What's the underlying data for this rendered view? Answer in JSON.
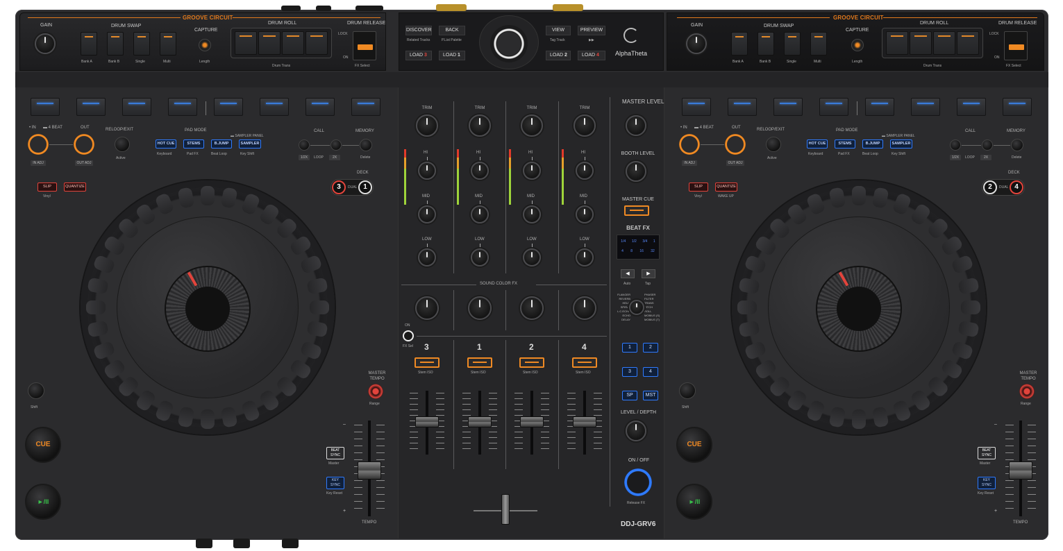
{
  "brand": {
    "logo_text": "AlphaTheta",
    "model": "DDJ-GRV6"
  },
  "browser": {
    "discover": "DISCOVER",
    "back": "BACK",
    "view": "VIEW",
    "preview": "PREVIEW",
    "related_tracks": "Related Tracks",
    "playlist_palette": "P.List Palette",
    "tag_track": "Tag Track",
    "forward": "▶▶",
    "load3": "LOAD",
    "load3_num": "3",
    "load1": "LOAD",
    "load1_num": "1",
    "load2": "LOAD",
    "load2_num": "2",
    "load4": "LOAD",
    "load4_num": "4"
  },
  "groove_left": {
    "title": "GROOVE CIRCUIT",
    "gain": "GAIN",
    "drum_swap": "DRUM SWAP",
    "capture": "CAPTURE",
    "drum_roll": "DRUM ROLL",
    "drum_release": "DRUM RELEASE",
    "lock": "LOCK",
    "on": "ON",
    "bank_a": "Bank A",
    "bank_b": "Bank B",
    "single": "Single",
    "multi": "Multi",
    "length": "Length",
    "drum_trans": "Drum Trans",
    "fx_select": "FX Select"
  },
  "groove_right": {
    "title": "GROOVE CIRCUIT",
    "gain": "GAIN",
    "drum_swap": "DRUM SWAP",
    "capture": "CAPTURE",
    "drum_roll": "DRUM ROLL",
    "drum_release": "DRUM RELEASE",
    "lock": "LOCK",
    "on": "ON",
    "bank_a": "Bank A",
    "bank_b": "Bank B",
    "single": "Single",
    "multi": "Multi",
    "length": "Length",
    "drum_trans": "Drum Trans",
    "fx_select": "FX Select"
  },
  "deck_left": {
    "in": "• IN",
    "beat4": "▬ 4 BEAT",
    "out": "OUT",
    "reloop": "RELOOP/EXIT",
    "in_adj": "IN ADJ",
    "out_adj": "OUT ADJ",
    "active": "Active",
    "pad_mode": "PAD MODE",
    "sampler_panel": "▬ SAMPLER PANEL",
    "hot_cue": "HOT CUE",
    "stems": "STEMS",
    "bjump": "B.JUMP",
    "sampler": "SAMPLER",
    "keyboard": "Keyboard",
    "pad_fx": "Pad FX",
    "beat_loop": "Beat Loop",
    "key_shift": "Key Shift",
    "call": "CALL",
    "memory": "MEMORY",
    "half": "1/2X",
    "loop": "LOOP",
    "double": "2X",
    "delete": "Delete",
    "deck": "DECK",
    "dual": "DUAL",
    "deck_a": "3",
    "deck_b": "1",
    "slip": "SLIP",
    "quantize": "QUANTIZE",
    "vinyl": "Vinyl",
    "sub2": "",
    "master_tempo": "MASTER TEMPO",
    "range": "Range",
    "shift": "Shift",
    "cue": "CUE",
    "play": "►/II",
    "beat_sync": "BEAT SYNC",
    "master": "Master",
    "key_sync": "KEY SYNC",
    "key_reset": "Key Reset",
    "minus": "–",
    "plus": "+",
    "tempo": "TEMPO"
  },
  "deck_right": {
    "in": "• IN",
    "beat4": "▬ 4 BEAT",
    "out": "OUT",
    "reloop": "RELOOP/EXIT",
    "in_adj": "IN ADJ",
    "out_adj": "OUT ADJ",
    "active": "Active",
    "pad_mode": "PAD MODE",
    "sampler_panel": "▬ SAMPLER PANEL",
    "hot_cue": "HOT CUE",
    "stems": "STEMS",
    "bjump": "B.JUMP",
    "sampler": "SAMPLER",
    "keyboard": "Keyboard",
    "pad_fx": "Pad FX",
    "beat_loop": "Beat Loop",
    "key_shift": "Key Shift",
    "call": "CALL",
    "memory": "MEMORY",
    "half": "1/2X",
    "loop": "LOOP",
    "double": "2X",
    "delete": "Delete",
    "deck": "DECK",
    "dual": "DUAL",
    "deck_a": "2",
    "deck_b": "4",
    "slip": "SLIP",
    "quantize": "QUANTIZE",
    "vinyl": "Vinyl",
    "sub2": "WAKE UP",
    "master_tempo": "MASTER TEMPO",
    "range": "Range",
    "shift": "Shift",
    "cue": "CUE",
    "play": "►/II",
    "beat_sync": "BEAT SYNC",
    "master": "Master",
    "key_sync": "KEY SYNC",
    "key_reset": "Key Reset",
    "minus": "–",
    "plus": "+",
    "tempo": "TEMPO"
  },
  "mixer": {
    "trim": "TRIM",
    "hi": "HI",
    "mid": "MID",
    "low": "LOW",
    "sound_color_fx": "SOUND COLOR FX",
    "on": "ON",
    "fx_sel": "FX Sel",
    "ch": [
      "3",
      "1",
      "2",
      "4"
    ],
    "stem_iso": "Stem ISO",
    "master_level": "MASTER LEVEL",
    "booth_level": "BOOTH LEVEL",
    "master_cue": "MASTER CUE",
    "beat_fx": "BEAT FX",
    "beats_row1": [
      "1/4",
      "1/2",
      "3/4",
      "1"
    ],
    "beats_row2": [
      "4",
      "8",
      "16",
      "32"
    ],
    "auto": "Auto",
    "tap": "Tap",
    "fx_names_left": [
      "FLANGER",
      "REVERB",
      "HELIX",
      "SPIRAL",
      "L.C.ECHO",
      "ECHO",
      "DELAY"
    ],
    "fx_names_right": [
      "PHASER",
      "FILTER",
      "TRANS",
      "PITCH",
      "ROLL",
      "MOBIUS (S)",
      "MOBIUS (T)"
    ],
    "assign": [
      "1",
      "2",
      "3",
      "4",
      "SP",
      "MST"
    ],
    "level_depth": "LEVEL / DEPTH",
    "on_off": "ON / OFF",
    "release_fx": "Release FX"
  },
  "colors": {
    "body": "#2b2b2d",
    "accent_orange": "#f08a23",
    "pad_blue": "#3a7bd9",
    "red": "#e2443c",
    "ring_blue": "#2f7bff"
  }
}
